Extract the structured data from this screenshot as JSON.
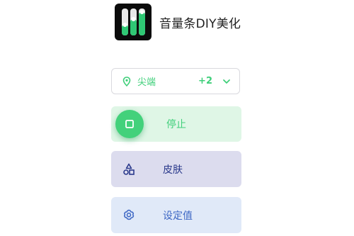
{
  "app": {
    "title": "音量条DIY美化",
    "icon": "volume-sliders-app-icon"
  },
  "selector": {
    "label": "尖端",
    "count": "+2",
    "icon": "location-pin-icon",
    "color": "#3fcf7a"
  },
  "buttons": {
    "stop": {
      "label": "停止",
      "icon": "stop-square-icon",
      "bg": "#dff6e6",
      "accent": "#43d17b"
    },
    "skin": {
      "label": "皮肤",
      "icon": "shapes-icon",
      "bg": "#dcdcee",
      "accent": "#2b3a8c"
    },
    "settings": {
      "label": "设定值",
      "icon": "gear-icon",
      "bg": "#e0e9f8",
      "accent": "#3c66c4"
    }
  }
}
